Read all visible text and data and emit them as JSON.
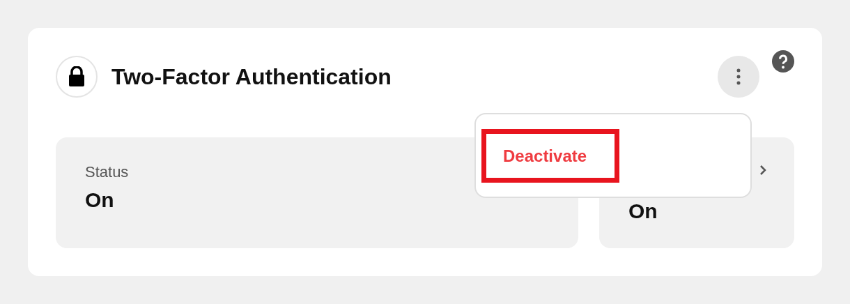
{
  "title": "Two-Factor Authentication",
  "tiles": [
    {
      "label": "Status",
      "value": "On"
    },
    {
      "value": "On"
    }
  ],
  "menu": {
    "open": true,
    "items": [
      {
        "label": "Deactivate",
        "highlighted": true
      }
    ]
  }
}
